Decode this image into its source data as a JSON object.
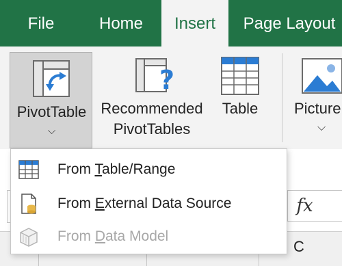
{
  "tabs": [
    {
      "label": "File",
      "active": false
    },
    {
      "label": "Home",
      "active": false
    },
    {
      "label": "Insert",
      "active": true
    },
    {
      "label": "Page Layout",
      "active": false
    }
  ],
  "ribbon": {
    "pivot_table": {
      "label": "PivotTable",
      "has_dropdown": true
    },
    "recommended": {
      "line1": "Recommended",
      "line2": "PivotTables"
    },
    "table": {
      "label": "Table"
    },
    "pictures": {
      "label": "Picture",
      "has_dropdown": true
    }
  },
  "sheet": {
    "fx_label": "fx",
    "column_c_label": "C"
  },
  "menu": {
    "items": [
      {
        "pre": "From ",
        "accel": "T",
        "post": "able/Range",
        "enabled": true
      },
      {
        "pre": "From ",
        "accel": "E",
        "post": "xternal Data Source",
        "enabled": true
      },
      {
        "pre": "From ",
        "accel": "D",
        "post": "ata Model",
        "enabled": false
      }
    ]
  },
  "colors": {
    "excel_green": "#217346",
    "ribbon_bg": "#f3f3f3",
    "pressed_button": "#d3d3d3",
    "disabled_text": "#a8a8a8",
    "icon_blue": "#2b7cd3"
  }
}
